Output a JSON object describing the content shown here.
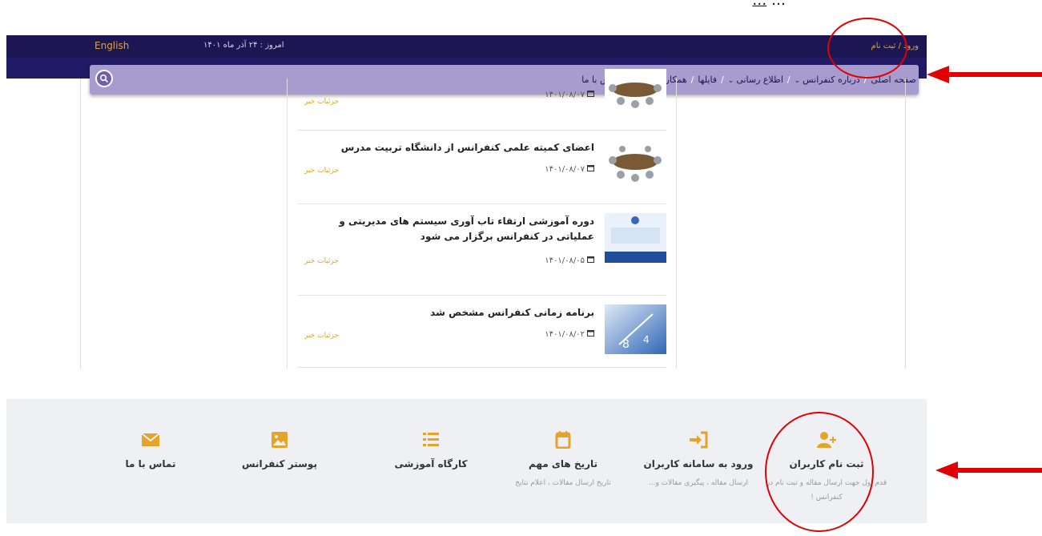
{
  "caption": {
    "before": "…",
    "underlined": "…"
  },
  "topbar": {
    "english": "English",
    "today": "امروز : ۲۴ آذر ماه ۱۴۰۱",
    "login": "ورود / ثبت نام"
  },
  "nav": {
    "items": [
      {
        "label": "صفحه اصلی",
        "dropdown": false
      },
      {
        "label": "درباره کنفرانس",
        "dropdown": true
      },
      {
        "label": "اطلاع رسانی",
        "dropdown": true
      },
      {
        "label": "فایلها",
        "dropdown": false
      },
      {
        "label": "همکاری با ما",
        "dropdown": true
      },
      {
        "label": "تماس با ما",
        "dropdown": false
      }
    ],
    "search_icon": "search-icon"
  },
  "news": [
    {
      "title": "",
      "date": "۱۴۰۱/۰۸/۰۷",
      "details": "جزئیات خبر"
    },
    {
      "title": "اعضای کمیته علمی کنفرانس از دانشگاه تربیت مدرس",
      "date": "۱۴۰۱/۰۸/۰۷",
      "details": "جزئیات خبر"
    },
    {
      "title": "دوره آموزشی ارتقاء تاب آوری سیستم های مدیریتی و عملیاتی در کنفرانس برگزار می شود",
      "date": "۱۴۰۱/۰۸/۰۵",
      "details": "جزئیات خبر"
    },
    {
      "title": "برنامه زمانی کنفرانس مشخص شد",
      "date": "۱۴۰۱/۰۸/۰۲",
      "details": "جزئیات خبر"
    }
  ],
  "footer": [
    {
      "title": "ثبت نام کاربران",
      "sub": "قدم اول جهت ارسال مقاله و ثبت نام در کنفرانس !",
      "icon": "user-plus-icon"
    },
    {
      "title": "ورود به سامانه کاربران",
      "sub": "ارسال مقاله ، پیگیری مقالات و...",
      "icon": "sign-in-icon"
    },
    {
      "title": "تاریخ های مهم",
      "sub": "تاریخ ارسال مقالات ، اعلام نتایج",
      "icon": "calendar-icon"
    },
    {
      "title": "کارگاه آموزشی",
      "sub": "",
      "icon": "list-icon"
    },
    {
      "title": "پوستر کنفرانس",
      "sub": "",
      "icon": "image-icon"
    },
    {
      "title": "تماس با ما",
      "sub": "",
      "icon": "envelope-icon"
    }
  ],
  "colors": {
    "topbar": "#1c1752",
    "nav": "#a89cce",
    "accent": "#e3a427",
    "annotation": "#e10000"
  }
}
